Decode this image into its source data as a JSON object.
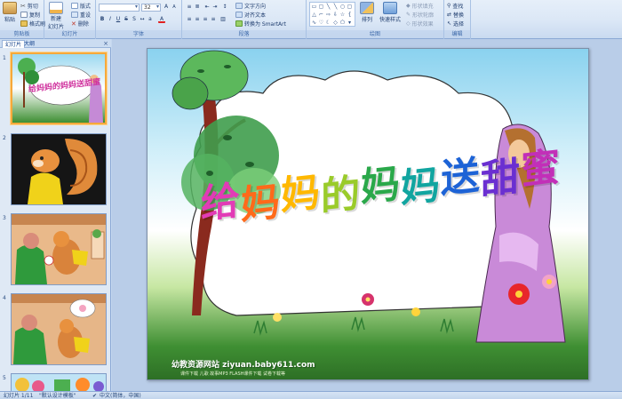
{
  "ribbon": {
    "clipboard": {
      "paste": "粘贴",
      "cut": "剪切",
      "copy": "复制",
      "format_painter": "格式刷",
      "label": "剪贴板"
    },
    "slides": {
      "new_slide": "新建",
      "new_slide_line2": "幻灯片",
      "layout": "版式",
      "reset": "重设",
      "delete": "删除",
      "label": "幻灯片"
    },
    "font": {
      "font_name": "",
      "font_size": "32",
      "label": "字体"
    },
    "paragraph": {
      "text_direction": "文字方向",
      "align_text": "对齐文本",
      "convert_smartart": "转换为 SmartArt",
      "label": "段落"
    },
    "drawing": {
      "arrange": "排列",
      "quick_styles": "快速样式",
      "shape_fill": "形状填充",
      "shape_outline": "形状轮廓",
      "shape_effects": "形状效果",
      "label": "绘图"
    },
    "editing": {
      "find": "查找",
      "replace": "替换",
      "select": "选择",
      "label": "编辑"
    }
  },
  "panel": {
    "tab_slides": "幻灯片",
    "tab_outline": "大纲",
    "close": "×",
    "slide_numbers": [
      "1",
      "2",
      "3",
      "4",
      "5"
    ]
  },
  "slide": {
    "title_chars": [
      "给",
      "妈",
      "妈",
      "的",
      "妈",
      "妈",
      "送",
      "甜",
      "蜜"
    ],
    "title_colors": [
      "#e23bb6",
      "#ff6a1a",
      "#ffb800",
      "#9acb2a",
      "#2aa84a",
      "#11a5a0",
      "#1d63d6",
      "#6a2fd1",
      "#c22fb8"
    ],
    "thumb_title": "给妈妈的妈妈送甜蜜",
    "footer_site": "幼教资源网站 ziyuan.baby611.com",
    "footer_links": "课件下载   儿歌   故事MP3   FLASH课件下载   试卷下载等"
  },
  "status": {
    "slide_counter": "幻灯片 1/11",
    "theme": "\"默认设计模板\"",
    "language": "中文(简体，中国)"
  },
  "colors": {
    "accent": "#f6a93b",
    "ribbon_bg": "#dbe7f6"
  }
}
